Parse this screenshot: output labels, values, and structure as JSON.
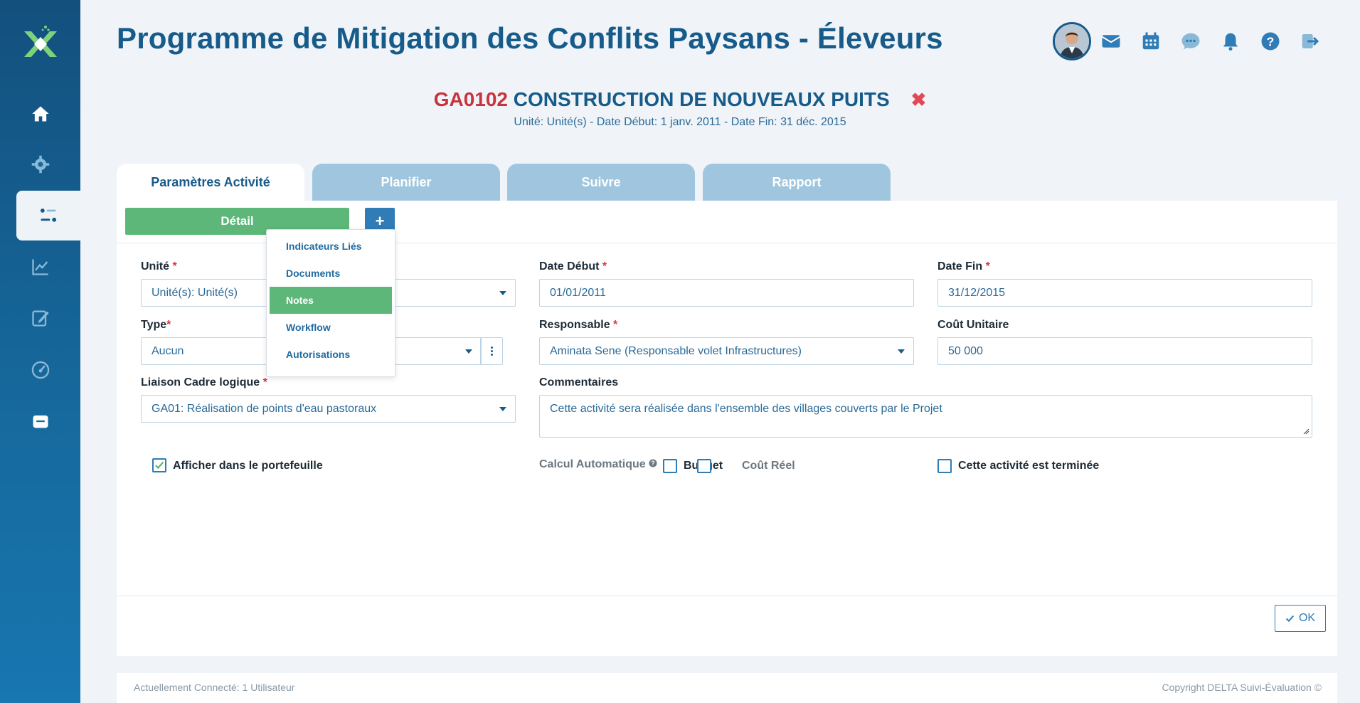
{
  "app": {
    "title": "Programme de Mitigation des Conflits Paysans - Éleveurs"
  },
  "sidebar": {
    "items": [
      {
        "icon": "home-icon"
      },
      {
        "icon": "gear-icon"
      },
      {
        "icon": "activities-icon",
        "active": true
      },
      {
        "icon": "chart-line-icon"
      },
      {
        "icon": "edit-icon"
      },
      {
        "icon": "gauge-icon"
      },
      {
        "icon": "folder-icon"
      }
    ]
  },
  "header_icons": [
    "avatar",
    "mail-icon",
    "calendar-icon",
    "chat-icon",
    "bell-icon",
    "help-icon",
    "logout-icon"
  ],
  "activity": {
    "code": "GA0102",
    "name": "CONSTRUCTION DE NOUVEAUX PUITS",
    "close_symbol": "✖",
    "subtitle": "Unité: Unité(s) - Date Début: 1 janv. 2011 - Date Fin: 31 déc. 2015"
  },
  "tabs": [
    {
      "label": "Paramètres Activité",
      "active": true
    },
    {
      "label": "Planifier",
      "active": false
    },
    {
      "label": "Suivre",
      "active": false
    },
    {
      "label": "Rapport",
      "active": false
    }
  ],
  "toolbar": {
    "detail_label": "Détail",
    "plus_label": "+"
  },
  "menu": {
    "items": [
      {
        "label": "Indicateurs Liés",
        "active": false
      },
      {
        "label": "Documents",
        "active": false
      },
      {
        "label": "Notes",
        "active": true
      },
      {
        "label": "Workflow",
        "active": false
      },
      {
        "label": "Autorisations",
        "active": false
      }
    ]
  },
  "form": {
    "unite": {
      "label": "Unité",
      "required": "*",
      "value": "Unité(s): Unité(s)"
    },
    "date_debut": {
      "label": "Date Début",
      "required": "*",
      "value": "01/01/2011"
    },
    "date_fin": {
      "label": "Date Fin",
      "required": "*",
      "value": "31/12/2015"
    },
    "type": {
      "label": "Type",
      "required": "*",
      "value": "Aucun"
    },
    "responsable": {
      "label": "Responsable",
      "required": "*",
      "value": "Aminata Sene (Responsable volet Infrastructures)"
    },
    "cout_unitaire": {
      "label": "Coût Unitaire",
      "value": "50 000"
    },
    "liaison": {
      "label": "Liaison Cadre logique",
      "required": "*",
      "value": "GA01: Réalisation de points d'eau pastoraux"
    },
    "commentaires": {
      "label": "Commentaires",
      "value": "Cette activité sera réalisée dans l'ensemble des villages couverts par le Projet"
    },
    "afficher_portefeuille": {
      "label": "Afficher dans le portefeuille",
      "checked": true
    },
    "calcul_auto": {
      "label": "Calcul Automatique"
    },
    "budget": {
      "label": "Budget",
      "checked": false
    },
    "cout_reel": {
      "label": "Coût Réel",
      "checked": false
    },
    "terminee": {
      "label": "Cette activité est terminée",
      "checked": false
    }
  },
  "ok_label": "OK",
  "footer": {
    "left": "Actuellement Connecté: 1 Utilisateur",
    "right": "Copyright DELTA Suivi-Évaluation ©"
  },
  "colors": {
    "primary": "#175b8a",
    "green": "#5cb779",
    "red": "#c8333c",
    "tab_inactive": "#9fc6de"
  }
}
